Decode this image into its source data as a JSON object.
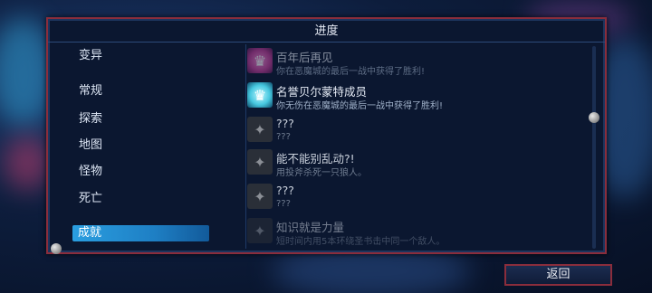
{
  "panel": {
    "title": "进度"
  },
  "categories": [
    {
      "label": "变异"
    },
    {
      "label": "常规"
    },
    {
      "label": "探索"
    },
    {
      "label": "地图"
    },
    {
      "label": "怪物"
    },
    {
      "label": "死亡"
    },
    {
      "label": "成就",
      "selected": true
    }
  ],
  "achievements": [
    {
      "title": "百年后再见",
      "desc": "你在恶魔城的最后一战中获得了胜利!",
      "icon": "crest-pink-icon"
    },
    {
      "title": "名誉贝尔蒙特成员",
      "desc": "你无伤在恶魔城的最后一战中获得了胜利!",
      "icon": "crest-cyan-icon"
    },
    {
      "title": "???",
      "desc": "???",
      "icon": "locked-icon"
    },
    {
      "title": "能不能别乱动?!",
      "desc": "用投斧杀死一只狼人。",
      "icon": "locked-icon"
    },
    {
      "title": "???",
      "desc": "???",
      "icon": "locked-icon"
    },
    {
      "title": "知识就是力量",
      "desc": "短时间内用5本环绕圣书击中同一个敌人。",
      "icon": "locked-icon"
    }
  ],
  "buttons": {
    "back": "返回"
  },
  "colors": {
    "accent": "#2a9ee0",
    "border": "#8a2d3c",
    "panel_bg": "#0b1730"
  }
}
